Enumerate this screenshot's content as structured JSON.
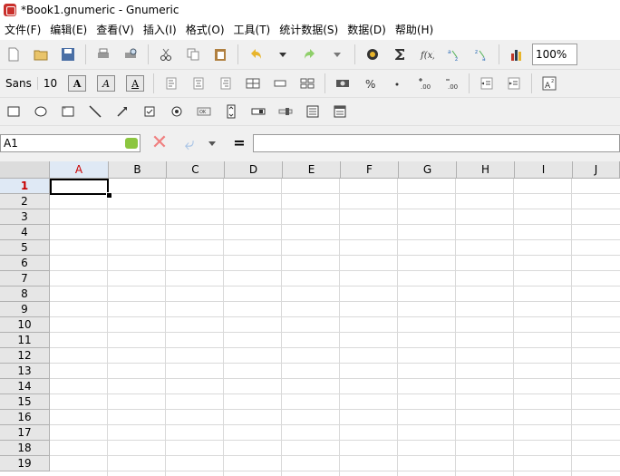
{
  "window": {
    "title": "*Book1.gnumeric - Gnumeric"
  },
  "menu": [
    "文件(F)",
    "编辑(E)",
    "查看(V)",
    "插入(I)",
    "格式(O)",
    "工具(T)",
    "统计数据(S)",
    "数据(D)",
    "帮助(H)"
  ],
  "toolbar": {
    "zoom": "100%",
    "font_name": "Sans",
    "font_size": "10"
  },
  "namebox": {
    "value": "A1"
  },
  "formula": {
    "equals": "=",
    "value": ""
  },
  "grid": {
    "active_cell": "A1",
    "columns": [
      "A",
      "B",
      "C",
      "D",
      "E",
      "F",
      "G",
      "H",
      "I",
      "J"
    ],
    "rows": [
      "1",
      "2",
      "3",
      "4",
      "5",
      "6",
      "7",
      "8",
      "9",
      "10",
      "11",
      "12",
      "13",
      "14",
      "15",
      "16",
      "17",
      "18",
      "19"
    ]
  },
  "colors": {
    "active_header_text": "#c80000",
    "accent_cancel": "#f08080"
  }
}
